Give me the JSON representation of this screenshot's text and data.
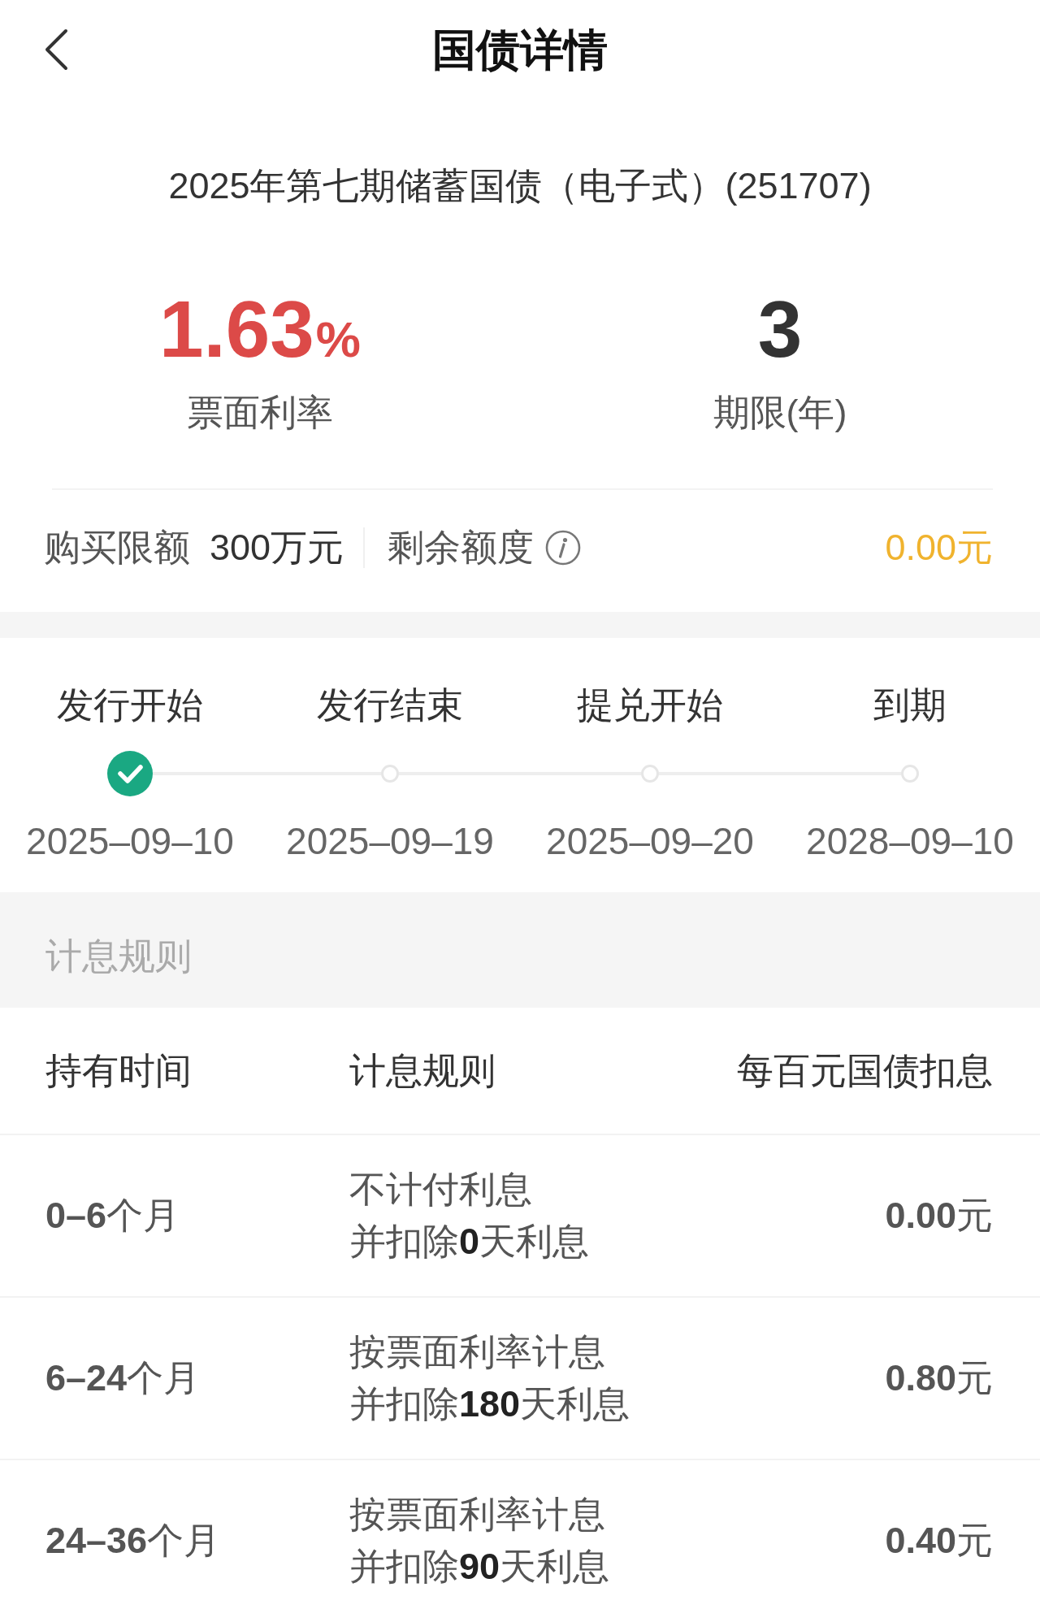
{
  "nav": {
    "title": "国债详情"
  },
  "bond": {
    "name": "2025年第七期储蓄国债（电子式）(251707)"
  },
  "stats": [
    {
      "kind": "rate",
      "value": "1.63",
      "unit": "%",
      "label": "票面利率"
    },
    {
      "kind": "term",
      "value": "3",
      "label": "期限(年)"
    }
  ],
  "quota": {
    "limit_label": "购买限额",
    "limit_value": "300万元",
    "remaining_label": "剩余额度",
    "remaining_value": "0.00元"
  },
  "timeline": [
    {
      "label": "发行开始",
      "date": "2025–09–10",
      "done": true
    },
    {
      "label": "发行结束",
      "date": "2025–09–19",
      "done": false
    },
    {
      "label": "提兑开始",
      "date": "2025–09–20",
      "done": false
    },
    {
      "label": "到期",
      "date": "2028–09–10",
      "done": false
    }
  ],
  "interest_rules": {
    "title": "计息规则",
    "columns": [
      "持有时间",
      "计息规则",
      "每百元国债扣息"
    ],
    "rows": [
      {
        "holding": "**0–6**个月",
        "rule": [
          "不计付利息",
          "并扣除**0**天利息"
        ],
        "deduction": "**0.00**元"
      },
      {
        "holding": "**6–24**个月",
        "rule": [
          "按票面利率计息",
          "并扣除**180**天利息"
        ],
        "deduction": "**0.80**元"
      },
      {
        "holding": "**24–36**个月",
        "rule": [
          "按票面利率计息",
          "并扣除**90**天利息"
        ],
        "deduction": "**0.40**元"
      }
    ]
  }
}
